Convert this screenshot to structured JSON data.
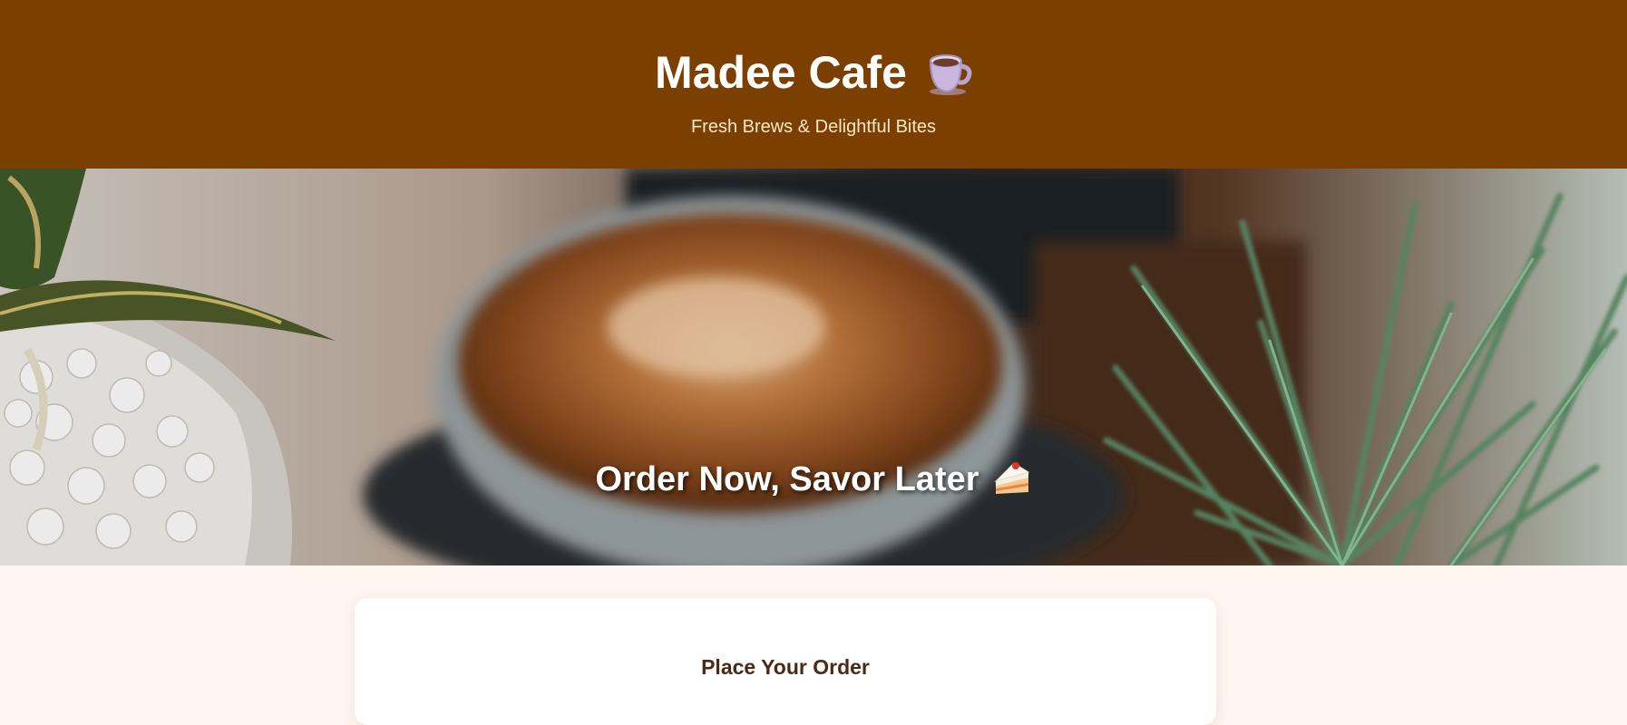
{
  "header": {
    "title": "Madee Cafe",
    "title_icon": "coffee-mug-icon",
    "tagline": "Fresh Brews & Delightful Bites",
    "background_color": "#7b3f00"
  },
  "hero": {
    "image": "latte-with-plants-photo",
    "headline": "Order Now, Savor Later",
    "headline_icon": "cake-slice-icon"
  },
  "order_form": {
    "title": "Place Your Order"
  },
  "colors": {
    "page_background": "#fff6f1",
    "accent": "#7b3f00",
    "heading_text": "#4a2a16"
  }
}
